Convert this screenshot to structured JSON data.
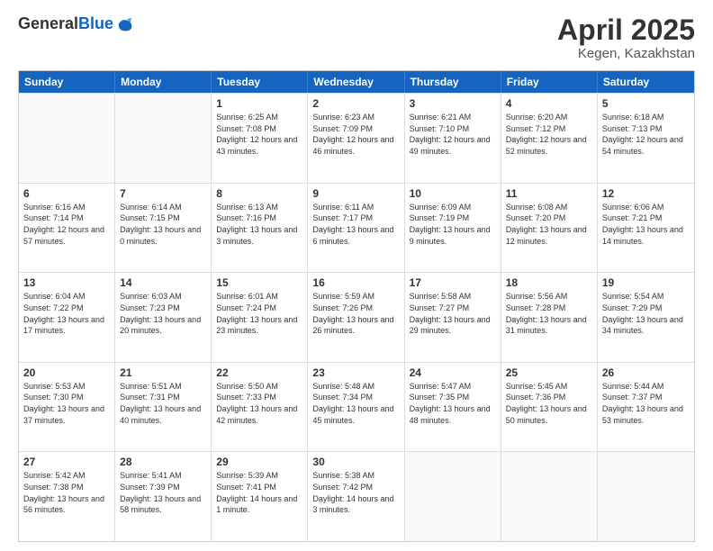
{
  "logo": {
    "general": "General",
    "blue": "Blue"
  },
  "title": {
    "month": "April 2025",
    "location": "Kegen, Kazakhstan"
  },
  "header_days": [
    "Sunday",
    "Monday",
    "Tuesday",
    "Wednesday",
    "Thursday",
    "Friday",
    "Saturday"
  ],
  "weeks": [
    [
      {
        "day": "",
        "empty": true
      },
      {
        "day": "",
        "empty": true
      },
      {
        "day": "1",
        "sunrise": "Sunrise: 6:25 AM",
        "sunset": "Sunset: 7:08 PM",
        "daylight": "Daylight: 12 hours and 43 minutes."
      },
      {
        "day": "2",
        "sunrise": "Sunrise: 6:23 AM",
        "sunset": "Sunset: 7:09 PM",
        "daylight": "Daylight: 12 hours and 46 minutes."
      },
      {
        "day": "3",
        "sunrise": "Sunrise: 6:21 AM",
        "sunset": "Sunset: 7:10 PM",
        "daylight": "Daylight: 12 hours and 49 minutes."
      },
      {
        "day": "4",
        "sunrise": "Sunrise: 6:20 AM",
        "sunset": "Sunset: 7:12 PM",
        "daylight": "Daylight: 12 hours and 52 minutes."
      },
      {
        "day": "5",
        "sunrise": "Sunrise: 6:18 AM",
        "sunset": "Sunset: 7:13 PM",
        "daylight": "Daylight: 12 hours and 54 minutes."
      }
    ],
    [
      {
        "day": "6",
        "sunrise": "Sunrise: 6:16 AM",
        "sunset": "Sunset: 7:14 PM",
        "daylight": "Daylight: 12 hours and 57 minutes."
      },
      {
        "day": "7",
        "sunrise": "Sunrise: 6:14 AM",
        "sunset": "Sunset: 7:15 PM",
        "daylight": "Daylight: 13 hours and 0 minutes."
      },
      {
        "day": "8",
        "sunrise": "Sunrise: 6:13 AM",
        "sunset": "Sunset: 7:16 PM",
        "daylight": "Daylight: 13 hours and 3 minutes."
      },
      {
        "day": "9",
        "sunrise": "Sunrise: 6:11 AM",
        "sunset": "Sunset: 7:17 PM",
        "daylight": "Daylight: 13 hours and 6 minutes."
      },
      {
        "day": "10",
        "sunrise": "Sunrise: 6:09 AM",
        "sunset": "Sunset: 7:19 PM",
        "daylight": "Daylight: 13 hours and 9 minutes."
      },
      {
        "day": "11",
        "sunrise": "Sunrise: 6:08 AM",
        "sunset": "Sunset: 7:20 PM",
        "daylight": "Daylight: 13 hours and 12 minutes."
      },
      {
        "day": "12",
        "sunrise": "Sunrise: 6:06 AM",
        "sunset": "Sunset: 7:21 PM",
        "daylight": "Daylight: 13 hours and 14 minutes."
      }
    ],
    [
      {
        "day": "13",
        "sunrise": "Sunrise: 6:04 AM",
        "sunset": "Sunset: 7:22 PM",
        "daylight": "Daylight: 13 hours and 17 minutes."
      },
      {
        "day": "14",
        "sunrise": "Sunrise: 6:03 AM",
        "sunset": "Sunset: 7:23 PM",
        "daylight": "Daylight: 13 hours and 20 minutes."
      },
      {
        "day": "15",
        "sunrise": "Sunrise: 6:01 AM",
        "sunset": "Sunset: 7:24 PM",
        "daylight": "Daylight: 13 hours and 23 minutes."
      },
      {
        "day": "16",
        "sunrise": "Sunrise: 5:59 AM",
        "sunset": "Sunset: 7:26 PM",
        "daylight": "Daylight: 13 hours and 26 minutes."
      },
      {
        "day": "17",
        "sunrise": "Sunrise: 5:58 AM",
        "sunset": "Sunset: 7:27 PM",
        "daylight": "Daylight: 13 hours and 29 minutes."
      },
      {
        "day": "18",
        "sunrise": "Sunrise: 5:56 AM",
        "sunset": "Sunset: 7:28 PM",
        "daylight": "Daylight: 13 hours and 31 minutes."
      },
      {
        "day": "19",
        "sunrise": "Sunrise: 5:54 AM",
        "sunset": "Sunset: 7:29 PM",
        "daylight": "Daylight: 13 hours and 34 minutes."
      }
    ],
    [
      {
        "day": "20",
        "sunrise": "Sunrise: 5:53 AM",
        "sunset": "Sunset: 7:30 PM",
        "daylight": "Daylight: 13 hours and 37 minutes."
      },
      {
        "day": "21",
        "sunrise": "Sunrise: 5:51 AM",
        "sunset": "Sunset: 7:31 PM",
        "daylight": "Daylight: 13 hours and 40 minutes."
      },
      {
        "day": "22",
        "sunrise": "Sunrise: 5:50 AM",
        "sunset": "Sunset: 7:33 PM",
        "daylight": "Daylight: 13 hours and 42 minutes."
      },
      {
        "day": "23",
        "sunrise": "Sunrise: 5:48 AM",
        "sunset": "Sunset: 7:34 PM",
        "daylight": "Daylight: 13 hours and 45 minutes."
      },
      {
        "day": "24",
        "sunrise": "Sunrise: 5:47 AM",
        "sunset": "Sunset: 7:35 PM",
        "daylight": "Daylight: 13 hours and 48 minutes."
      },
      {
        "day": "25",
        "sunrise": "Sunrise: 5:45 AM",
        "sunset": "Sunset: 7:36 PM",
        "daylight": "Daylight: 13 hours and 50 minutes."
      },
      {
        "day": "26",
        "sunrise": "Sunrise: 5:44 AM",
        "sunset": "Sunset: 7:37 PM",
        "daylight": "Daylight: 13 hours and 53 minutes."
      }
    ],
    [
      {
        "day": "27",
        "sunrise": "Sunrise: 5:42 AM",
        "sunset": "Sunset: 7:38 PM",
        "daylight": "Daylight: 13 hours and 56 minutes."
      },
      {
        "day": "28",
        "sunrise": "Sunrise: 5:41 AM",
        "sunset": "Sunset: 7:39 PM",
        "daylight": "Daylight: 13 hours and 58 minutes."
      },
      {
        "day": "29",
        "sunrise": "Sunrise: 5:39 AM",
        "sunset": "Sunset: 7:41 PM",
        "daylight": "Daylight: 14 hours and 1 minute."
      },
      {
        "day": "30",
        "sunrise": "Sunrise: 5:38 AM",
        "sunset": "Sunset: 7:42 PM",
        "daylight": "Daylight: 14 hours and 3 minutes."
      },
      {
        "day": "",
        "empty": true
      },
      {
        "day": "",
        "empty": true
      },
      {
        "day": "",
        "empty": true
      }
    ]
  ]
}
